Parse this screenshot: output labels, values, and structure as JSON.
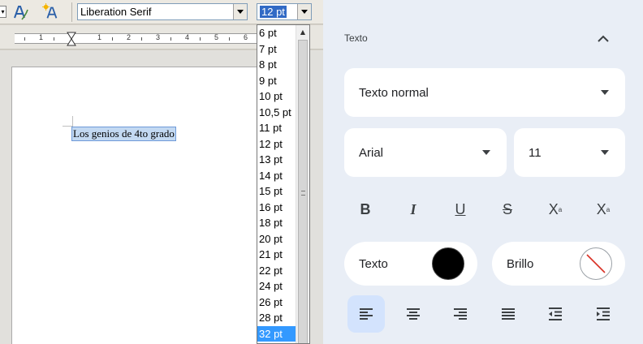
{
  "writer": {
    "font_name": "Liberation Serif",
    "font_size": "12 pt",
    "ruler_numbers": [
      "1",
      "1",
      "2",
      "3",
      "4",
      "5",
      "6"
    ],
    "document_text": "Los genios de 4to grado",
    "size_options": [
      "6 pt",
      "7 pt",
      "8 pt",
      "9 pt",
      "10 pt",
      "10,5 pt",
      "11 pt",
      "12 pt",
      "13 pt",
      "14 pt",
      "15 pt",
      "16 pt",
      "18 pt",
      "20 pt",
      "21 pt",
      "22 pt",
      "24 pt",
      "26 pt",
      "28 pt",
      "32 pt"
    ],
    "highlighted_option": "32 pt"
  },
  "panel": {
    "section_title": "Texto",
    "style_dropdown": "Texto normal",
    "font_dropdown": "Arial",
    "size_dropdown": "11",
    "format_buttons": [
      {
        "name": "bold",
        "glyph": "B"
      },
      {
        "name": "italic",
        "glyph": "I"
      },
      {
        "name": "underline",
        "glyph": "U"
      },
      {
        "name": "strikethrough",
        "glyph": "S"
      },
      {
        "name": "superscript",
        "glyph": "X"
      },
      {
        "name": "subscript",
        "glyph": "X"
      }
    ],
    "text_color_label": "Texto",
    "text_color": "#000000",
    "highlight_label": "Brillo",
    "highlight_color": "none",
    "accent": "#d3e3fd"
  }
}
